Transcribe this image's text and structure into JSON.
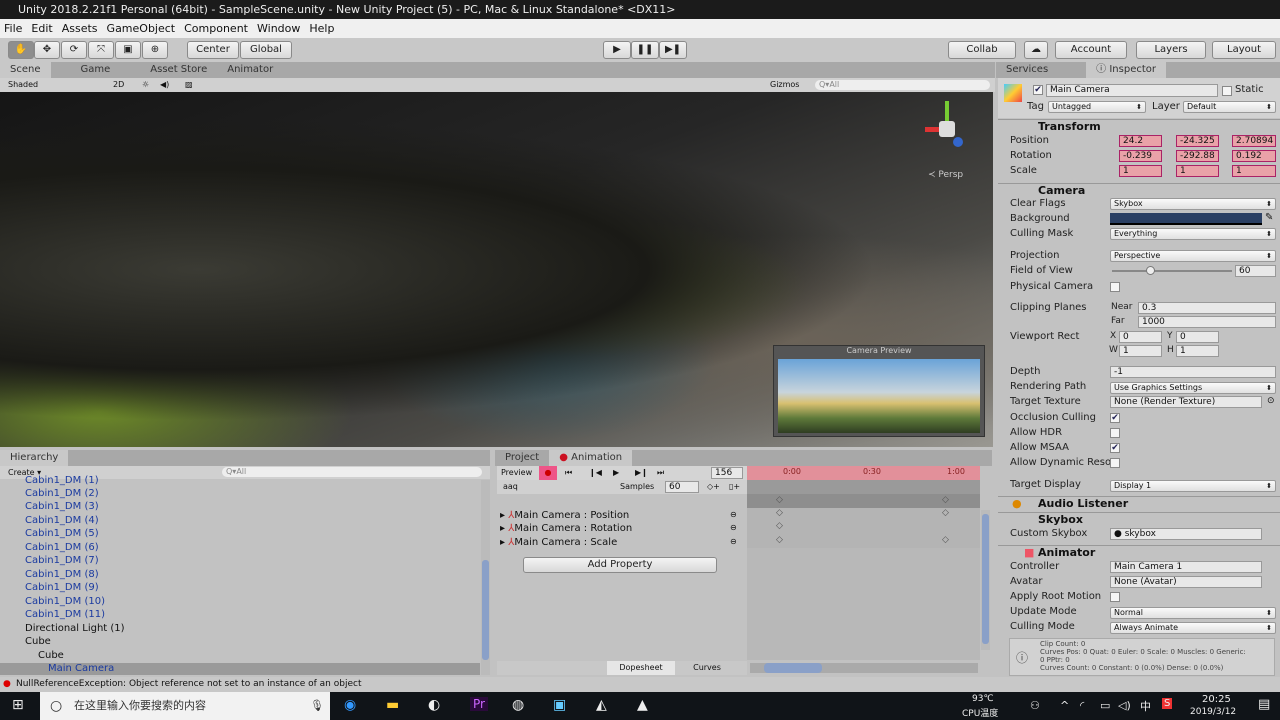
{
  "window": {
    "title": "Unity 2018.2.21f1 Personal (64bit) - SampleScene.unity - New Unity Project (5) - PC, Mac & Linux Standalone* <DX11>"
  },
  "menu": [
    "File",
    "Edit",
    "Assets",
    "GameObject",
    "Component",
    "Window",
    "Help"
  ],
  "toolbar": {
    "pivot": "Center",
    "space": "Global",
    "collab": "Collab",
    "account": "Account",
    "layers": "Layers",
    "layout": "Layout"
  },
  "scene_tabs": [
    "Scene",
    "Game",
    "Asset Store",
    "Animator"
  ],
  "scene_toolbar": {
    "shading": "Shaded",
    "mode_2d": "2D",
    "gizmos": "Gizmos",
    "search_placeholder": "Q▾All",
    "persp": "≺ Persp",
    "camera_preview": "Camera Preview"
  },
  "hierarchy": {
    "tab": "Hierarchy",
    "create": "Create ▾",
    "search_placeholder": "Q▾All",
    "items": [
      "Cabin1_DM (1)",
      "Cabin1_DM (2)",
      "Cabin1_DM (3)",
      "Cabin1_DM (4)",
      "Cabin1_DM (5)",
      "Cabin1_DM (6)",
      "Cabin1_DM (7)",
      "Cabin1_DM (8)",
      "Cabin1_DM (9)",
      "Cabin1_DM (10)",
      "Cabin1_DM (11)"
    ],
    "directional_light": "Directional Light (1)",
    "cube": "Cube",
    "cube_child": "Cube",
    "main_camera": "Main Camera"
  },
  "animation": {
    "tabs": [
      "Project",
      "Animation"
    ],
    "preview": "Preview",
    "frame": "156",
    "clip": "aaq",
    "samples_label": "Samples",
    "samples": "60",
    "ticks": [
      "0:00",
      "0:30",
      "1:00"
    ],
    "properties": [
      "Main Camera : Position",
      "Main Camera : Rotation",
      "Main Camera : Scale"
    ],
    "add_property": "Add Property",
    "dopesheet": "Dopesheet",
    "curves": "Curves"
  },
  "inspector": {
    "tabs": [
      "Services",
      "Inspector"
    ],
    "name": "Main Camera",
    "static": "Static",
    "tag_label": "Tag",
    "tag": "Untagged",
    "layer_label": "Layer",
    "layer": "Default",
    "transform": {
      "title": "Transform",
      "position_label": "Position",
      "rotation_label": "Rotation",
      "scale_label": "Scale",
      "position": [
        "24.2",
        "-24.325",
        "2.70894"
      ],
      "rotation": [
        "-0.239",
        "-292.88",
        "0.192"
      ],
      "scale": [
        "1",
        "1",
        "1"
      ]
    },
    "camera": {
      "title": "Camera",
      "clear_flags_label": "Clear Flags",
      "clear_flags": "Skybox",
      "background_label": "Background",
      "background_color": "#2a3f63",
      "culling_mask_label": "Culling Mask",
      "culling_mask": "Everything",
      "projection_label": "Projection",
      "projection": "Perspective",
      "fov_label": "Field of View",
      "fov": "60",
      "physical_label": "Physical Camera",
      "clipping_label": "Clipping Planes",
      "near_label": "Near",
      "near": "0.3",
      "far_label": "Far",
      "far": "1000",
      "viewport_label": "Viewport Rect",
      "vx": "0",
      "vy": "0",
      "vw": "1",
      "vh": "1",
      "depth_label": "Depth",
      "depth": "-1",
      "rendering_label": "Rendering Path",
      "rendering": "Use Graphics Settings",
      "target_texture_label": "Target Texture",
      "target_texture": "None (Render Texture)",
      "occlusion_label": "Occlusion Culling",
      "hdr_label": "Allow HDR",
      "msaa_label": "Allow MSAA",
      "dynres_label": "Allow Dynamic Resolu",
      "target_display_label": "Target Display",
      "target_display": "Display 1"
    },
    "audio_listener": "Audio Listener",
    "skybox": {
      "title": "Skybox",
      "custom_label": "Custom Skybox",
      "custom": "skybox"
    },
    "animator": {
      "title": "Animator",
      "controller_label": "Controller",
      "controller": "Main Camera 1",
      "avatar_label": "Avatar",
      "avatar": "None (Avatar)",
      "root_motion_label": "Apply Root Motion",
      "update_label": "Update Mode",
      "update": "Normal",
      "culling_label": "Culling Mode",
      "culling": "Always Animate",
      "info": [
        "Clip Count: 0",
        "Curves Pos: 0 Quat: 0 Euler: 0 Scale: 0 Muscles: 0 Generic:",
        "0 PPtr: 0",
        "Curves Count: 0 Constant: 0 (0.0%) Dense: 0 (0.0%)"
      ]
    }
  },
  "status": {
    "error": "NullReferenceException: Object reference not set to an instance of an object"
  },
  "taskbar": {
    "search_placeholder": "在这里输入你要搜索的内容",
    "temp": "93℃",
    "temp_label": "CPU温度",
    "ime": "中",
    "time": "20:25",
    "date": "2019/3/12"
  }
}
